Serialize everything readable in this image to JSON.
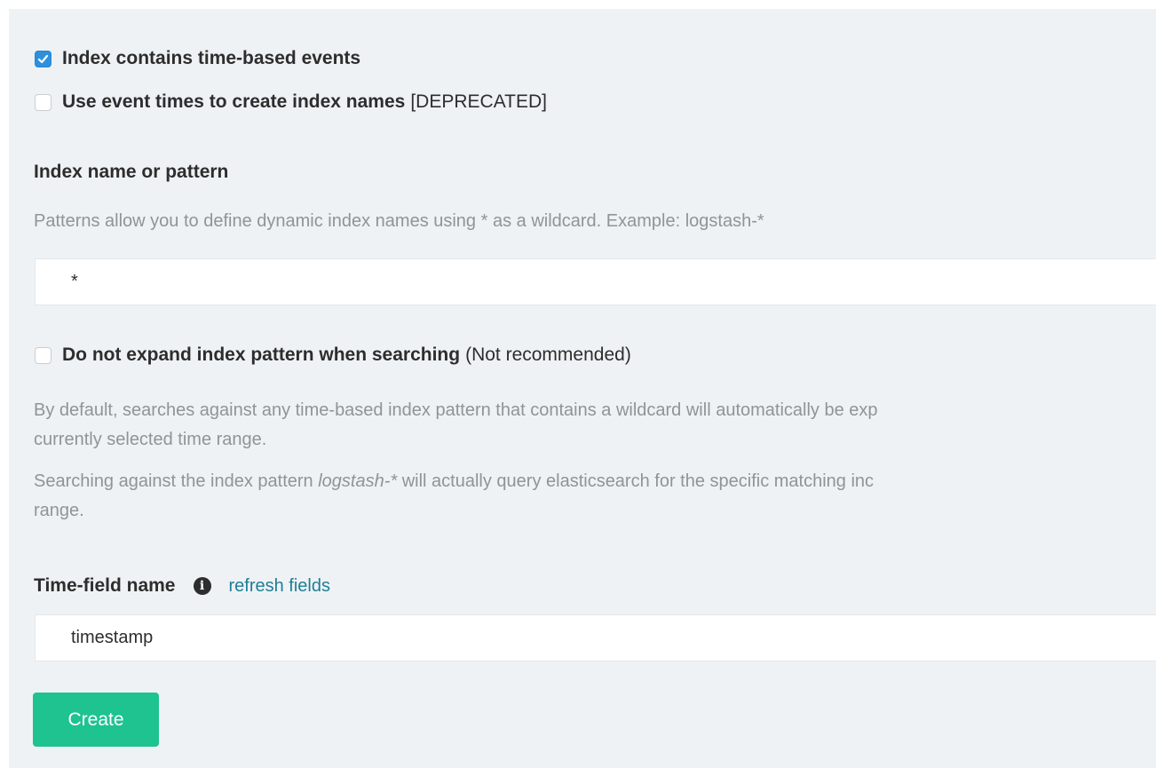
{
  "options": {
    "time_based": {
      "label": "Index contains time-based events",
      "checked": true
    },
    "event_times": {
      "label": "Use event times to create index names",
      "suffix": "[DEPRECATED]",
      "checked": false
    }
  },
  "index_pattern": {
    "label": "Index name or pattern",
    "help": "Patterns allow you to define dynamic index names using * as a wildcard. Example: logstash-*",
    "value": "*"
  },
  "expand": {
    "label": "Do not expand index pattern when searching",
    "suffix": "(Not recommended)",
    "checked": false,
    "help_1_line_1": "By default, searches against any time-based index pattern that contains a wildcard will automatically be exp",
    "help_1_line_2": "currently selected time range.",
    "help_2_line_1_pre": "Searching against the index pattern ",
    "help_2_line_1_em": "logstash-*",
    "help_2_line_1_post": " will actually query elasticsearch for the specific matching inc",
    "help_2_line_2": "range."
  },
  "time_field": {
    "label": "Time-field name",
    "info_icon_glyph": "i",
    "refresh_link": "refresh fields",
    "value": "timestamp"
  },
  "actions": {
    "create_label": "Create"
  },
  "colors": {
    "panel_bg": "#eff2f4",
    "checkbox_checked": "#2e90dd",
    "link": "#1f7e97",
    "create_button": "#1ec38f"
  }
}
